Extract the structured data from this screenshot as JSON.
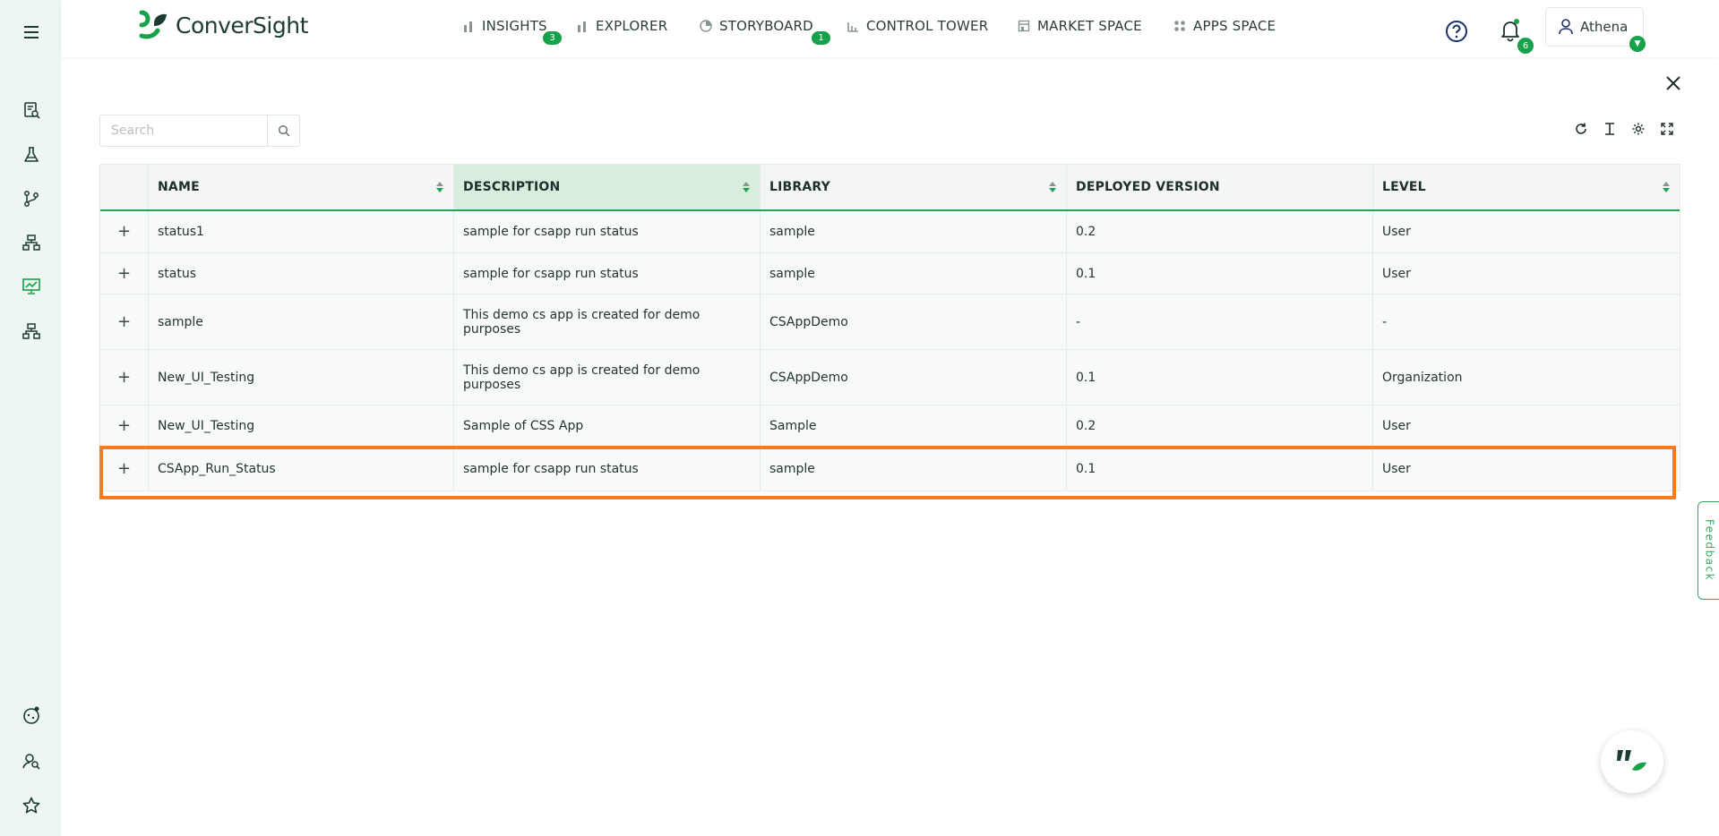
{
  "app": {
    "brand": "ConverSight"
  },
  "nav": {
    "items": [
      {
        "label": "INSIGHTS",
        "badge": "3"
      },
      {
        "label": "EXPLORER"
      },
      {
        "label": "STORYBOARD",
        "badge": "1"
      },
      {
        "label": "CONTROL TOWER"
      },
      {
        "label": "MARKET SPACE"
      },
      {
        "label": "APPS SPACE"
      }
    ]
  },
  "header": {
    "notifications_count": "6",
    "user_name": "Athena"
  },
  "search": {
    "placeholder": "Search",
    "value": ""
  },
  "table": {
    "columns": [
      "NAME",
      "DESCRIPTION",
      "LIBRARY",
      "DEPLOYED VERSION",
      "LEVEL"
    ],
    "sorted_column": "DESCRIPTION",
    "rows": [
      {
        "name": "status1",
        "description": "sample for csapp run status",
        "library": "sample",
        "version": "0.2",
        "level": "User"
      },
      {
        "name": "status",
        "description": "sample for csapp run status",
        "library": "sample",
        "version": "0.1",
        "level": "User"
      },
      {
        "name": "sample",
        "description": "This demo cs app is created for demo purposes",
        "library": "CSAppDemo",
        "version": "-",
        "level": "-"
      },
      {
        "name": "New_UI_Testing",
        "description": "This demo cs app is created for demo purposes",
        "library": "CSAppDemo",
        "version": "0.1",
        "level": "Organization"
      },
      {
        "name": "New_UI_Testing",
        "description": "Sample of CSS App",
        "library": "Sample",
        "version": "0.2",
        "level": "User"
      },
      {
        "name": "CSApp_Run_Status",
        "description": "sample for csapp run status",
        "library": "sample",
        "version": "0.1",
        "level": "User"
      }
    ],
    "highlighted_row": 5,
    "expand_symbol": "+"
  },
  "feedback": {
    "label": "Feedback"
  },
  "colors": {
    "accent": "#17a14a",
    "highlight": "#f47c20",
    "sidebar_bg": "#eef6f1"
  },
  "icons": {
    "sidebar_top": [
      "menu-icon"
    ],
    "sidebar_nav": [
      "report-search-icon",
      "flask-icon",
      "branch-icon",
      "hierarchy-icon",
      "presentation-chart-icon",
      "org-chart-icon"
    ],
    "sidebar_bottom": [
      "bot-icon",
      "user-search-icon",
      "star-icon"
    ],
    "toolbar": [
      "refresh-icon",
      "text-height-icon",
      "settings-icon",
      "expand-icon"
    ]
  }
}
